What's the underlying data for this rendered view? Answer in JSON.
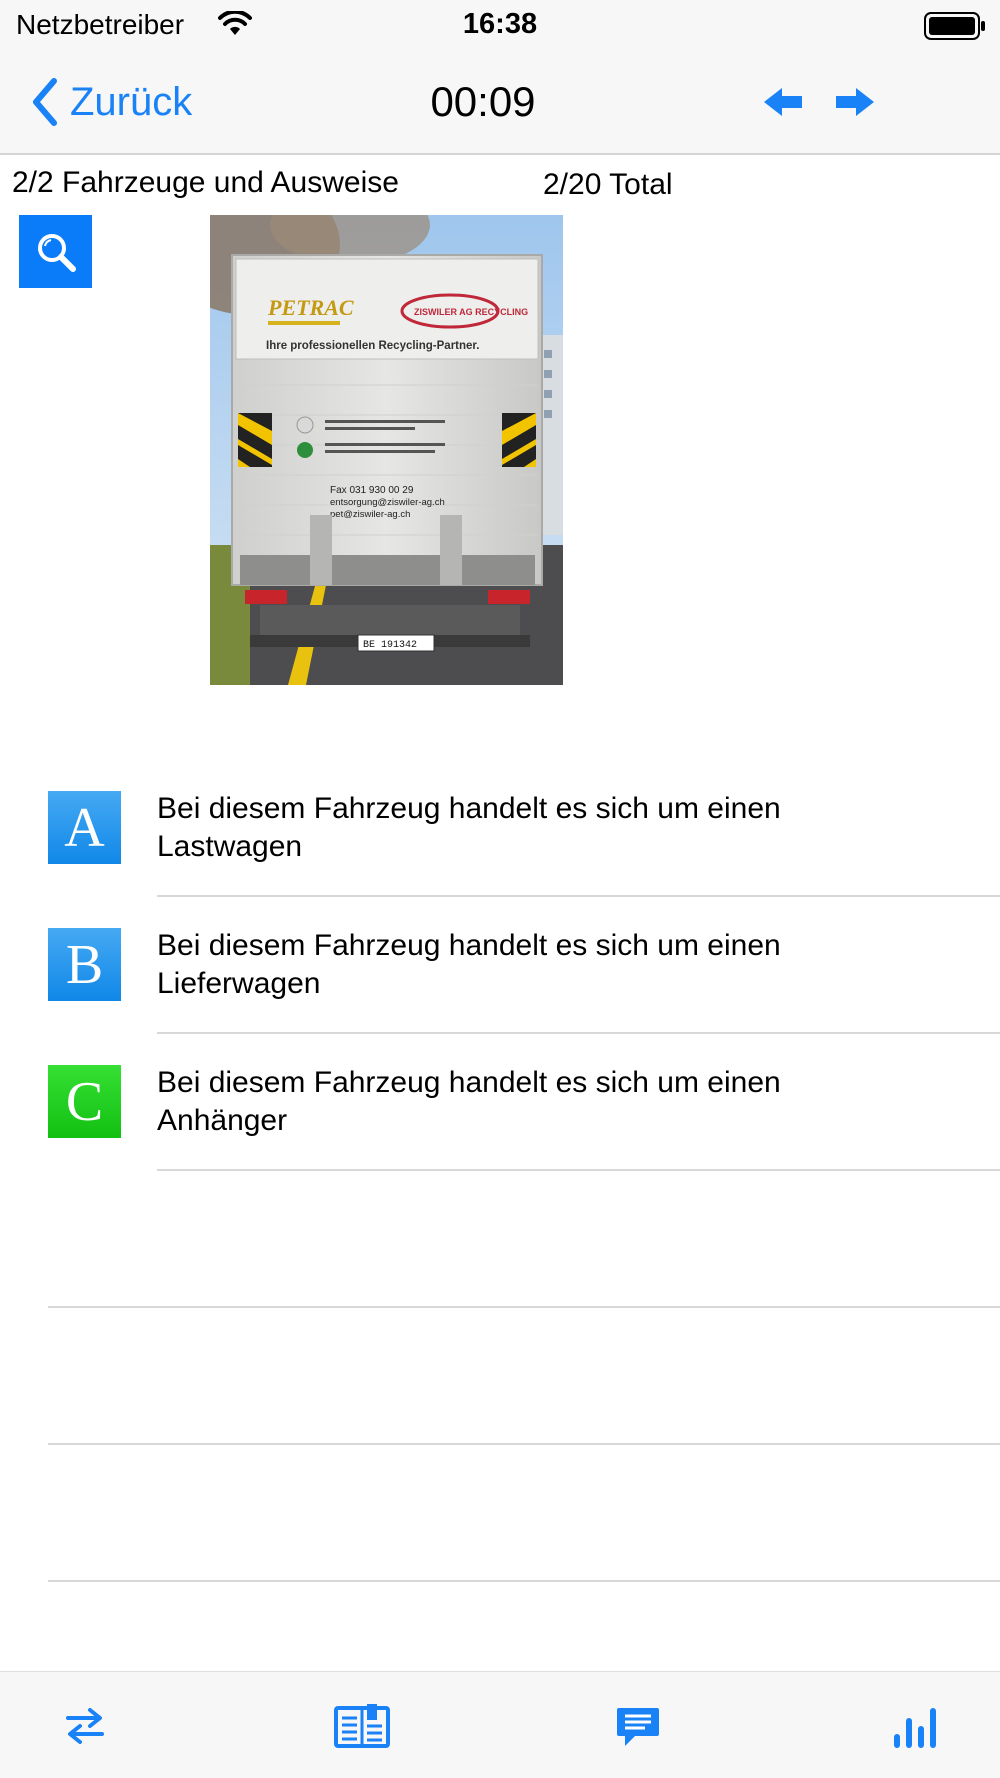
{
  "status_bar": {
    "carrier": "Netzbetreiber",
    "time": "16:38",
    "icons": [
      "wifi-icon",
      "battery-icon"
    ]
  },
  "nav": {
    "back_label": "Zurück",
    "timer": "00:09",
    "prev_icon": "arrow-left-icon",
    "next_icon": "arrow-right-icon",
    "accent_color": "#1a82f7"
  },
  "question": {
    "progress_label": "2/2 Fahrzeuge und Ausweise",
    "total_label": "2/20 Total",
    "zoom_icon": "magnifier-icon",
    "photo": {
      "sign_brand": "PETRAC",
      "sign_partner": "ZISWILER AG RECYCLING",
      "sign_tagline": "Ihre professionellen Recycling-Partner.",
      "fax": "Fax 031 930 00 29",
      "email1": "entsorgung@ziswiler-ag.ch",
      "email2": "pet@ziswiler-ag.ch",
      "plate": "BE 191342"
    }
  },
  "answers": [
    {
      "letter": "A",
      "text": "Bei diesem Fahrzeug handelt es sich um einen Lastwagen",
      "color": "blue"
    },
    {
      "letter": "B",
      "text": "Bei diesem Fahrzeug handelt es sich um einen Lieferwagen",
      "color": "blue"
    },
    {
      "letter": "C",
      "text": "Bei diesem Fahrzeug handelt es sich um einen Anhänger",
      "color": "green"
    }
  ],
  "tab_bar": {
    "icons": [
      "swap-icon",
      "book-icon",
      "chat-icon",
      "stats-icon"
    ],
    "color": "#1a82f7"
  }
}
